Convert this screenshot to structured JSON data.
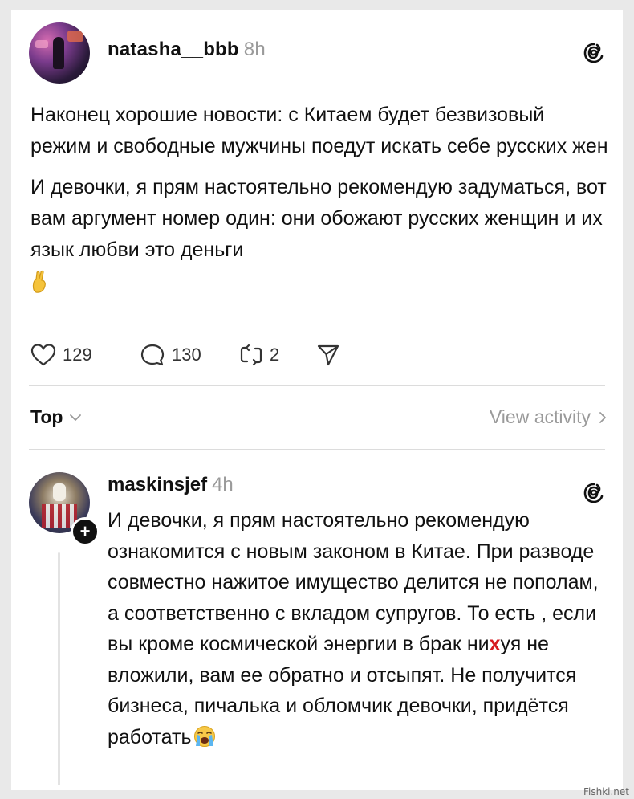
{
  "post": {
    "username": "natasha__bbb",
    "time": "8h",
    "paragraph1": "Наконец хорошие новости: с Китаем будет безвизовый режим и свободные мужчины поедут искать себе русских жен",
    "paragraph2": "И девочки, я прям настоятельно рекомендую задуматься, вот вам аргумент номер один: они обожают русских женщин и их язык любви это деньги",
    "emoji": "crossed-fingers",
    "likes": "129",
    "comments": "130",
    "reposts": "2",
    "icons": {
      "like": "heart-icon",
      "comment": "comment-icon",
      "repost": "repost-icon",
      "share": "send-icon",
      "app": "threads-icon"
    }
  },
  "sortbar": {
    "sort_label": "Top",
    "view_activity": "View activity"
  },
  "reply": {
    "username": "maskinsjef",
    "time": "4h",
    "text_before_mark": "И девочки, я прям настоятельно рекомендую ознакомится с новым законом в Китае. При разводе совместно нажитое имущество делится не пополам,  а соответственно с вкладом супругов. То есть , если вы кроме космической энергии в брак ни",
    "mark": "х",
    "text_after_mark": "уя не вложили, вам ее обратно и отсыпят. Не получится бизнеса, пичалька и обломчик девочки, придётся работать",
    "emoji": "loudly-crying-face"
  },
  "watermark": "Fishki.net",
  "colors": {
    "accent_mark": "#d61b20",
    "muted": "#9a9a9a"
  }
}
